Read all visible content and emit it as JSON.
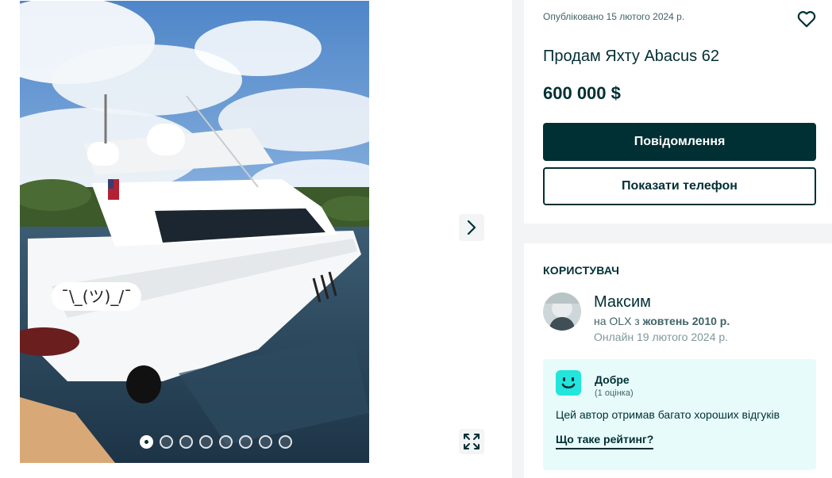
{
  "listing": {
    "published": "Опубліковано 15 лютого 2024 р.",
    "title": "Продам Яхту Abacus 62",
    "price": "600 000 $",
    "message_button": "Повідомлення",
    "phone_button": "Показати телефон"
  },
  "gallery": {
    "overlay_text": "¯\\_(ツ)_/¯",
    "photo_count": 8,
    "current_photo": 1
  },
  "user": {
    "section_title": "КОРИСТУВАЧ",
    "name": "Максим",
    "since_prefix": "на OLX з ",
    "since_date": "жовтень 2010 р.",
    "online": "Онлайн 19 лютого 2024 р."
  },
  "rating": {
    "label": "Добре",
    "count": "(1 оцінка)",
    "description": "Цей автор отримав багато хороших відгуків",
    "link": "Що таке рейтинг?"
  },
  "colors": {
    "primary": "#002f34",
    "rating_bg": "#e8fbfb",
    "rating_icon": "#23e5db"
  },
  "icons": [
    "chevron-right-icon",
    "expand-icon",
    "heart-icon",
    "smile-icon"
  ]
}
